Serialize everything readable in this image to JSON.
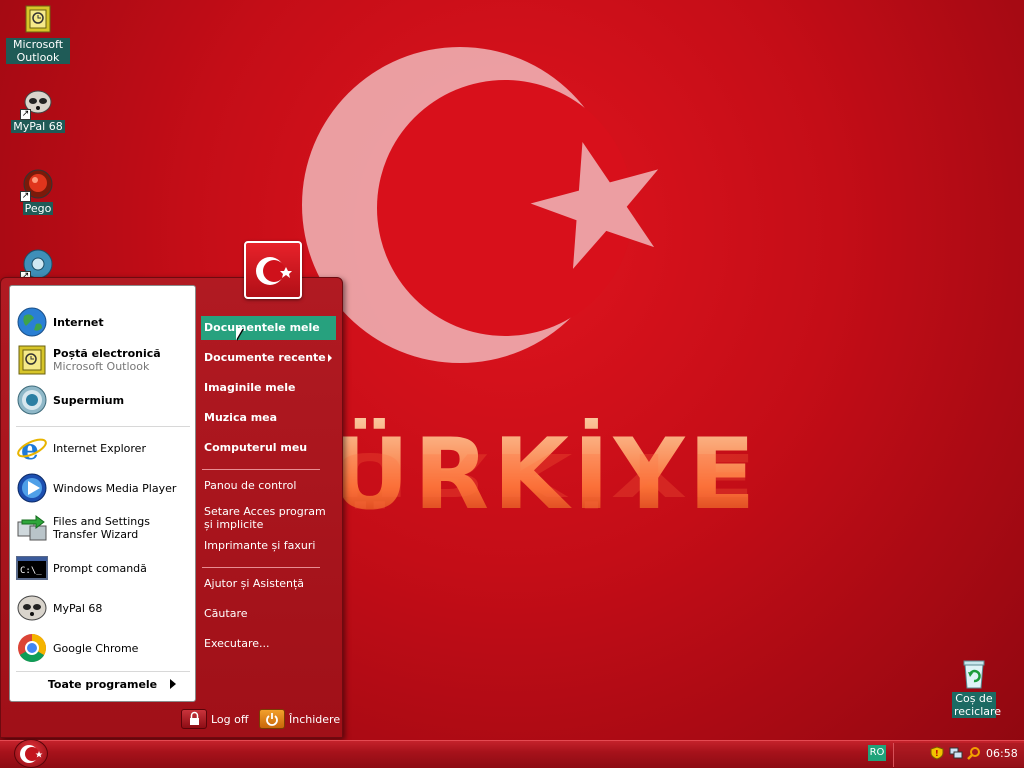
{
  "wallpaper": {
    "text": "ÜRKİYE"
  },
  "desktop_icons": [
    {
      "label": "Microsoft Outlook",
      "icon": "outlook-icon"
    },
    {
      "label": "MyPal 68",
      "icon": "mypal-icon"
    },
    {
      "label": "Pego",
      "icon": "pego-icon"
    },
    {
      "label": "",
      "icon": "supermium-icon"
    },
    {
      "label": "Coș de reciclare",
      "icon": "recycle-bin-icon"
    }
  ],
  "start_menu": {
    "pinned": [
      {
        "title": "Internet",
        "subtitle": "",
        "icon": "globe-icon"
      },
      {
        "title": "Poștă electronică",
        "subtitle": "Microsoft Outlook",
        "icon": "outlook-icon"
      },
      {
        "title": "Supermium",
        "subtitle": "",
        "icon": "supermium-icon"
      }
    ],
    "recent": [
      {
        "title": "Internet Explorer",
        "icon": "ie-icon"
      },
      {
        "title": "Windows Media Player",
        "icon": "wmp-icon"
      },
      {
        "title": "Files and Settings Transfer Wizard",
        "icon": "transfer-wizard-icon"
      },
      {
        "title": "Prompt comandă",
        "icon": "cmd-icon"
      },
      {
        "title": "MyPal 68",
        "icon": "mypal-icon"
      },
      {
        "title": "Google Chrome",
        "icon": "chrome-icon"
      }
    ],
    "all_programs": "Toate programele",
    "right": [
      {
        "label": "Documentele mele"
      },
      {
        "label": "Documente recente"
      },
      {
        "label": "Imaginile mele"
      },
      {
        "label": "Muzica mea"
      },
      {
        "label": "Computerul meu"
      },
      {
        "label": "Panou de control"
      },
      {
        "label": "Setare Acces program și implicite"
      },
      {
        "label": "Imprimante și faxuri"
      },
      {
        "label": "Ajutor și Asistență"
      },
      {
        "label": "Căutare"
      },
      {
        "label": "Executare..."
      }
    ],
    "log_off": "Log off",
    "shutdown": "Închidere"
  },
  "taskbar": {
    "language": "RO",
    "clock": "06:58"
  },
  "colors": {
    "flag_red": "#d90f1a",
    "highlight": "#27a17e",
    "label_bg": "#1f5b57"
  }
}
